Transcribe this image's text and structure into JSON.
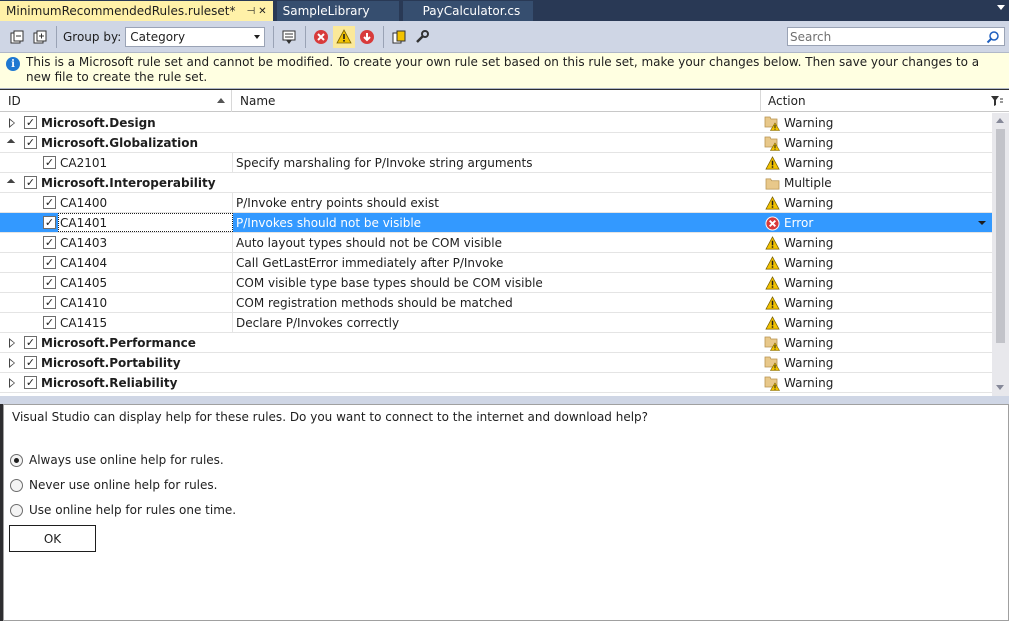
{
  "tabs": [
    {
      "label": "MinimumRecommendedRules.ruleset*",
      "active": true
    },
    {
      "label": "SampleLibrary",
      "active": false
    },
    {
      "label": "PayCalculator.cs",
      "active": false
    }
  ],
  "toolbar": {
    "group_by_label": "Group by:",
    "group_by_value": "Category",
    "search_placeholder": "Search"
  },
  "info": {
    "message": "This is a Microsoft rule set and cannot be modified. To create your own rule set based on this rule set, make your changes below. Then save your changes to a new file to create the rule set."
  },
  "grid": {
    "columns": {
      "id": "ID",
      "name": "Name",
      "action": "Action"
    },
    "rows": [
      {
        "kind": "category",
        "expanded": false,
        "id": "Microsoft.Design",
        "name": "",
        "action": "Warning",
        "action_icon": "folder-warning-icon"
      },
      {
        "kind": "category",
        "expanded": true,
        "id": "Microsoft.Globalization",
        "name": "",
        "action": "Warning",
        "action_icon": "folder-warning-icon"
      },
      {
        "kind": "rule",
        "id": "CA2101",
        "name": "Specify marshaling for P/Invoke string arguments",
        "action": "Warning",
        "action_icon": "warning-icon"
      },
      {
        "kind": "category",
        "expanded": true,
        "id": "Microsoft.Interoperability",
        "name": "",
        "action": "Multiple",
        "action_icon": "folder-icon"
      },
      {
        "kind": "rule",
        "id": "CA1400",
        "name": "P/Invoke entry points should exist",
        "action": "Warning",
        "action_icon": "warning-icon"
      },
      {
        "kind": "rule",
        "id": "CA1401",
        "name": "P/Invokes should not be visible",
        "action": "Error",
        "action_icon": "error-icon",
        "selected": true
      },
      {
        "kind": "rule",
        "id": "CA1403",
        "name": "Auto layout types should not be COM visible",
        "action": "Warning",
        "action_icon": "warning-icon"
      },
      {
        "kind": "rule",
        "id": "CA1404",
        "name": "Call GetLastError immediately after P/Invoke",
        "action": "Warning",
        "action_icon": "warning-icon"
      },
      {
        "kind": "rule",
        "id": "CA1405",
        "name": "COM visible type base types should be COM visible",
        "action": "Warning",
        "action_icon": "warning-icon"
      },
      {
        "kind": "rule",
        "id": "CA1410",
        "name": "COM registration methods should be matched",
        "action": "Warning",
        "action_icon": "warning-icon"
      },
      {
        "kind": "rule",
        "id": "CA1415",
        "name": "Declare P/Invokes correctly",
        "action": "Warning",
        "action_icon": "warning-icon"
      },
      {
        "kind": "category",
        "expanded": false,
        "id": "Microsoft.Performance",
        "name": "",
        "action": "Warning",
        "action_icon": "folder-warning-icon"
      },
      {
        "kind": "category",
        "expanded": false,
        "id": "Microsoft.Portability",
        "name": "",
        "action": "Warning",
        "action_icon": "folder-warning-icon"
      },
      {
        "kind": "category",
        "expanded": false,
        "id": "Microsoft.Reliability",
        "name": "",
        "action": "Warning",
        "action_icon": "folder-warning-icon"
      }
    ]
  },
  "help": {
    "question": "Visual Studio can display help for these rules. Do you want to connect to the internet and download help?",
    "options": [
      {
        "label": "Always use online help for rules.",
        "selected": true
      },
      {
        "label": "Never use online help for rules.",
        "selected": false
      },
      {
        "label": "Use online help for rules one time.",
        "selected": false
      }
    ],
    "ok_label": "OK"
  },
  "colors": {
    "tab_active": "#fff1a8",
    "selection": "#3399ff",
    "warning": "#f2c200",
    "error": "#d83b3b"
  }
}
